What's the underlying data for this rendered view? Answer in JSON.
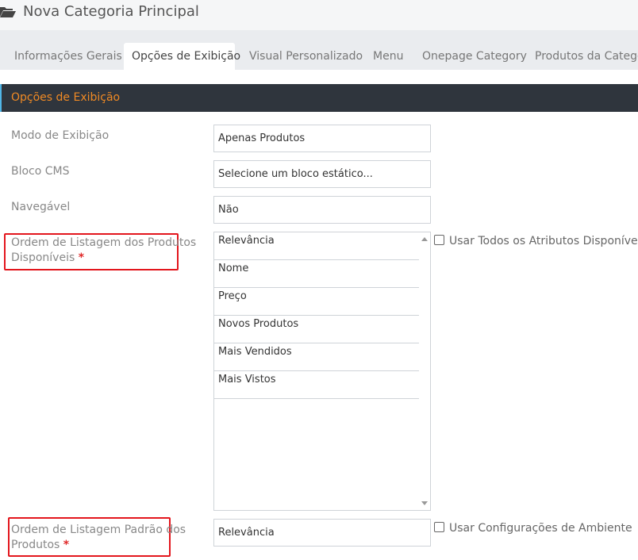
{
  "header": {
    "title": "Nova Categoria Principal",
    "icon": "folder-open-icon"
  },
  "tabs": [
    {
      "label": "Informações Gerais",
      "active": false
    },
    {
      "label": "Opções de Exibição",
      "active": true
    },
    {
      "label": "Visual Personalizado",
      "active": false
    },
    {
      "label": "Menu",
      "active": false
    },
    {
      "label": "Onepage Category",
      "active": false
    },
    {
      "label": "Produtos da Categoria",
      "active": false
    }
  ],
  "section": {
    "title": "Opções de Exibição"
  },
  "form": {
    "display_mode": {
      "label": "Modo de Exibição",
      "value": "Apenas Produtos"
    },
    "cms_block": {
      "label": "Bloco CMS",
      "value": "Selecione um bloco estático..."
    },
    "anchor": {
      "label": "Navegável",
      "value": "Não"
    },
    "available_sort": {
      "label_line1": "Ordem de Listagem dos Produtos",
      "label_line2": "Disponíveis",
      "required_mark": "*",
      "options": [
        "Relevância",
        "Nome",
        "Preço",
        "Novos Produtos",
        "Mais Vendidos",
        "Mais Vistos"
      ],
      "checkbox_label": "Usar Todos os Atributos Disponíveis"
    },
    "default_sort": {
      "label_line1": "Ordem de Listagem Padrão dos",
      "label_line2": "Produtos",
      "required_mark": "*",
      "value": "Relevância",
      "checkbox_label": "Usar Configurações de Ambiente"
    }
  },
  "colors": {
    "accent": "#f08a24",
    "section_bg": "#2f353d",
    "highlight": "#e3161d",
    "required": "#e02a2a"
  }
}
